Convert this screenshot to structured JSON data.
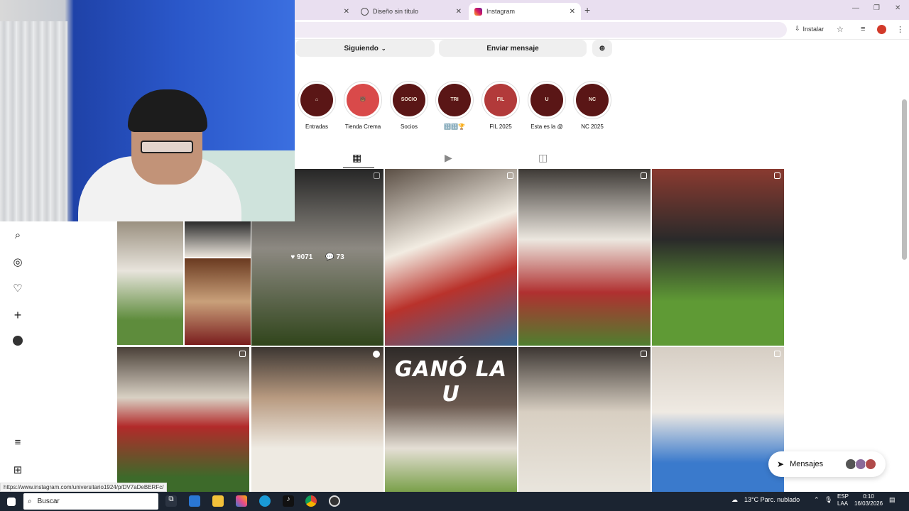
{
  "browser": {
    "tabs": [
      {
        "label": "Diseño sin título",
        "active": false
      },
      {
        "label": "Instagram",
        "active": true
      }
    ],
    "install_label": "Instalar"
  },
  "profile": {
    "following_label": "Siguiendo",
    "message_label": "Enviar mensaje"
  },
  "highlights": [
    {
      "label": "Entradas",
      "glyph": "⌂"
    },
    {
      "label": "Tienda Crema",
      "glyph": "🐻"
    },
    {
      "label": "Socios",
      "glyph": "SOCIO"
    },
    {
      "label": "🔢🔢🏆",
      "glyph": "TRI"
    },
    {
      "label": "FIL 2025",
      "glyph": "FIL"
    },
    {
      "label": "Esta es la @",
      "glyph": "U"
    },
    {
      "label": "NC 2025",
      "glyph": "NC"
    }
  ],
  "post_hover": {
    "likes": "9071",
    "comments": "73"
  },
  "tile_text": {
    "gano": "GANÓ LA U"
  },
  "messages_label": "Mensajes",
  "status_url": "https://www.instagram.com/universitario1924/p/DV7aDeBERFc/",
  "taskbar": {
    "search_placeholder": "Buscar",
    "weather": "13°C  Parc. nublado",
    "lang_top": "ESP",
    "lang_bottom": "LAA",
    "time": "0:10",
    "date": "16/03/2026"
  },
  "colors": {
    "brand_maroon": "#5a1616",
    "tab_bg": "#e9dff0"
  }
}
